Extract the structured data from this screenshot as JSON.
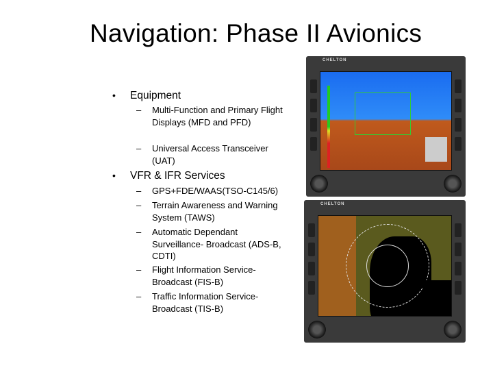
{
  "slide": {
    "title": "Navigation:  Phase II Avionics",
    "sections": [
      {
        "label": "Equipment",
        "items": [
          "Multi-Function and Primary Flight Displays (MFD and PFD)",
          "Universal Access Transceiver (UAT)"
        ]
      },
      {
        "label": "VFR & IFR Services",
        "items": [
          "GPS+FDE/WAAS(TSO-C145/6)",
          "Terrain Awareness and Warning System (TAWS)",
          "Automatic Dependant Surveillance- Broadcast (ADS-B, CDTI)",
          "Flight Information Service- Broadcast (FIS-B)",
          "Traffic Information Service- Broadcast (TIS-B)"
        ]
      }
    ],
    "bullet": "•",
    "dash": "–"
  },
  "images": {
    "pfd": {
      "logo": "CHELTON",
      "sky_color": "#1a6cf0",
      "ground_color": "#c05a1c"
    },
    "mfd": {
      "logo": "CHELTON",
      "terrain_color": "#5a5a1e",
      "water_color": "#000000"
    }
  }
}
